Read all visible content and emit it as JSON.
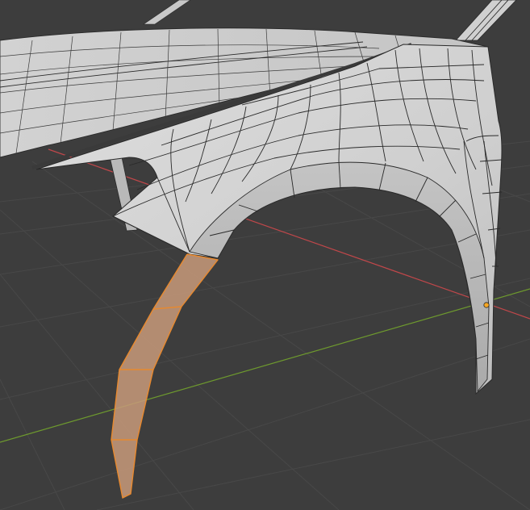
{
  "app": "3D Viewport",
  "viewport": {
    "background_color": "#3d3d3d",
    "grid_color": "#484848",
    "x_axis_color": "#c0474a",
    "y_axis_color": "#6e9a2e",
    "mesh_face_color": "#d6d6d6",
    "mesh_edge_color": "#2a2a2a",
    "selection_face_color": "#c89a7a",
    "selection_edge_color": "#e8892e",
    "selected_vertex_color": "#f5a623"
  },
  "scene": {
    "object": "fender-mesh",
    "selected_faces": 4
  }
}
